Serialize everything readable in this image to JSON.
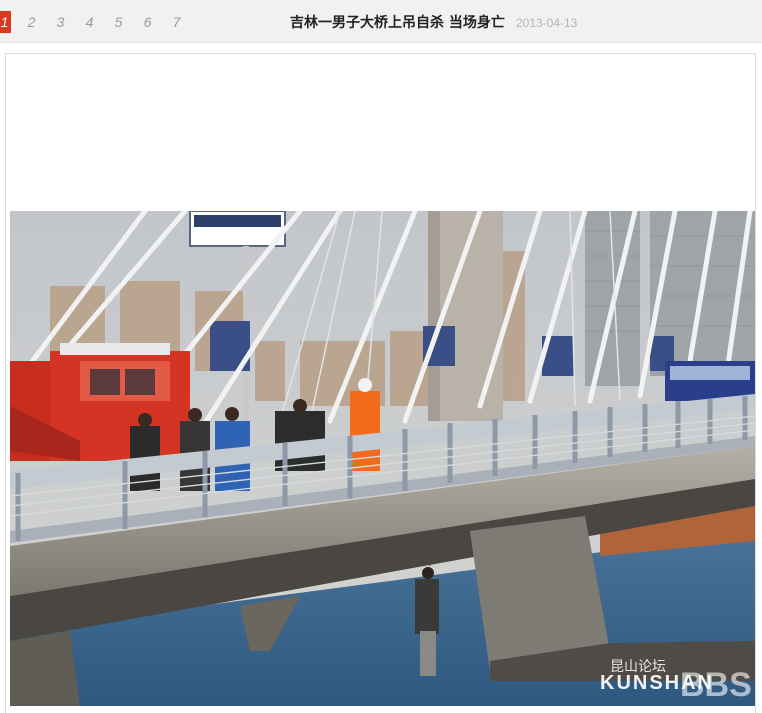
{
  "pager": {
    "pages": [
      "1",
      "2",
      "3",
      "4",
      "5",
      "6",
      "7"
    ],
    "active_index": 0
  },
  "article": {
    "title": "吉林一男子大桥上吊自杀  当场身亡",
    "date": "2013-04-13"
  },
  "watermark": {
    "text": "昆山论坛 KUNSHAN BBS"
  },
  "colors": {
    "active_page": "#d93a1f",
    "sky": "#c9ccd0",
    "water": "#3f6b93"
  }
}
